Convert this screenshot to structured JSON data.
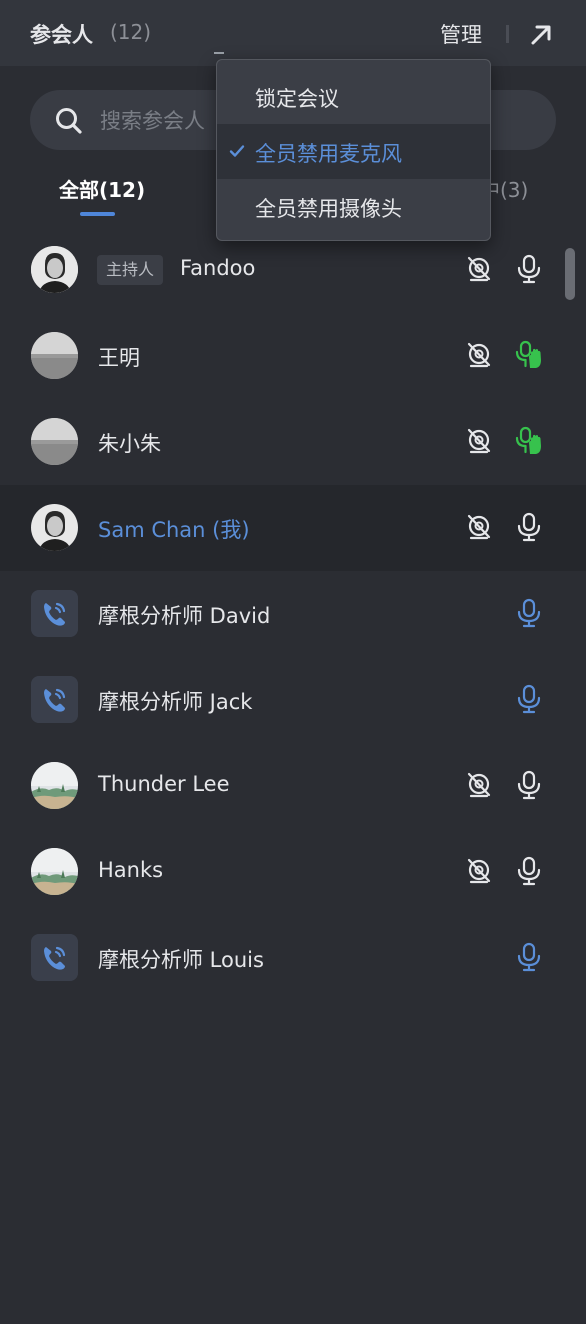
{
  "header": {
    "title": "参会人",
    "count": "(12)",
    "manage_label": "管理",
    "popout_icon": "arrow-up-right-icon"
  },
  "search": {
    "placeholder": "搜索参会人"
  },
  "tabs": [
    {
      "label": "全部(12)",
      "active": true
    },
    {
      "label": "中(3)",
      "active": false
    }
  ],
  "dropdown": {
    "items": [
      {
        "label": "锁定会议",
        "checked": false
      },
      {
        "label": "全员禁用麦克风",
        "checked": true
      },
      {
        "label": "全员禁用摄像头",
        "checked": false
      }
    ]
  },
  "participants": [
    {
      "name": "Fandoo",
      "badge": "主持人",
      "avatar": "photo-man",
      "camera": "camera-off-icon",
      "mic": "mic-icon",
      "mic_color": "#e6e7ea"
    },
    {
      "name": "王明",
      "avatar": "photo-gray",
      "camera": "camera-off-icon",
      "mic": "mic-raised-hand-icon",
      "mic_color": "#37c24d"
    },
    {
      "name": "朱小朱",
      "avatar": "photo-gray",
      "camera": "camera-off-icon",
      "mic": "mic-raised-hand-icon",
      "mic_color": "#37c24d"
    },
    {
      "name": "Sam Chan (我)",
      "avatar": "photo-man",
      "camera": "camera-off-icon",
      "mic": "mic-icon",
      "mic_color": "#e6e7ea",
      "is_me": true
    },
    {
      "name": "摩根分析师 David",
      "avatar": "phone-call-icon",
      "mic": "mic-icon",
      "mic_color": "#5b8fd9"
    },
    {
      "name": "摩根分析师 Jack",
      "avatar": "phone-call-icon",
      "mic": "mic-icon",
      "mic_color": "#5b8fd9"
    },
    {
      "name": "Thunder Lee",
      "avatar": "photo-landscape",
      "camera": "camera-off-icon",
      "mic": "mic-icon",
      "mic_color": "#e6e7ea"
    },
    {
      "name": "Hanks",
      "avatar": "photo-landscape",
      "camera": "camera-off-icon",
      "mic": "mic-icon",
      "mic_color": "#e6e7ea"
    },
    {
      "name": "摩根分析师 Louis",
      "avatar": "phone-call-icon",
      "mic": "mic-icon",
      "mic_color": "#5b8fd9"
    }
  ],
  "colors": {
    "accent": "#5b8fd9",
    "raised_hand": "#37c24d",
    "background": "#2b2d33"
  }
}
